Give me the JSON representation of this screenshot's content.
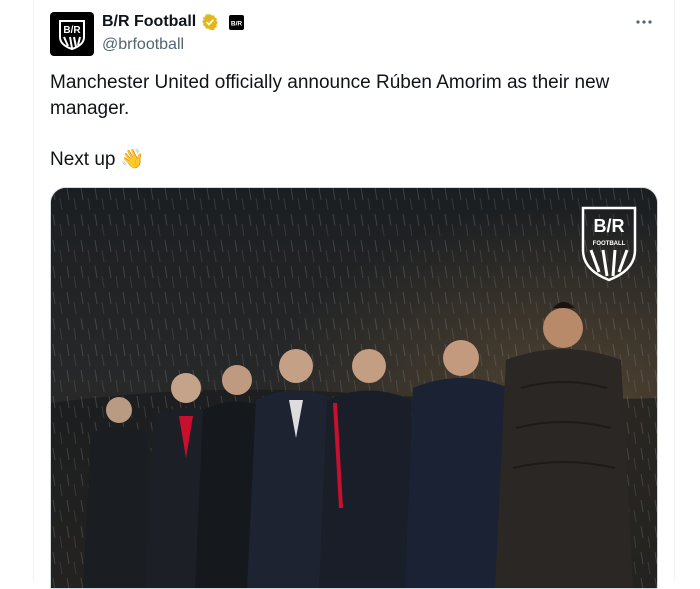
{
  "account": {
    "display_name": "B/R Football",
    "handle": "@brfootball",
    "avatar_text": "B/R",
    "affiliate_badge_text": "B/R"
  },
  "tweet": {
    "line1": "Manchester United officially announce Rúben Amorim as their new manager.",
    "line2": "Next up",
    "emoji": "👋"
  },
  "media": {
    "watermark_text": "B/R",
    "watermark_subtext": "FOOTBALL",
    "colors": {
      "bg_top": "#1b1e21",
      "bg_bottom": "#3a342c",
      "accent_red": "#c8102e"
    }
  },
  "colors": {
    "verified_gold": "#e2b719",
    "handle_gray": "#536471",
    "text": "#0f1419"
  },
  "icons": {
    "verified": "verified-badge-icon",
    "more": "more-options-icon"
  }
}
